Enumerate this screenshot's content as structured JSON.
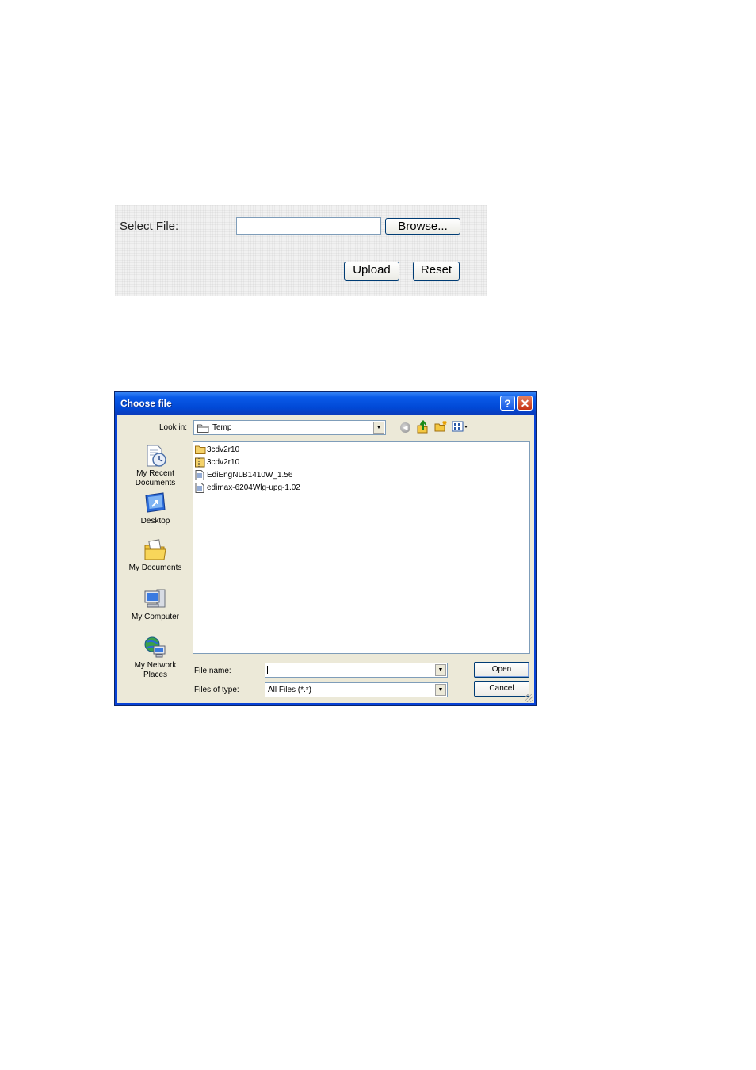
{
  "upload_form": {
    "select_file_label": "Select File:",
    "file_path_value": "",
    "browse_label": "Browse...",
    "upload_label": "Upload",
    "reset_label": "Reset"
  },
  "dialog": {
    "title": "Choose file",
    "help_glyph": "?",
    "close_glyph": "✕",
    "look_in_label": "Look in:",
    "look_in_value": "Temp",
    "toolbar_icons": [
      "back-icon",
      "up-one-level-icon",
      "new-folder-icon",
      "views-menu-icon"
    ],
    "places": [
      {
        "label": "My Recent Documents",
        "icon": "recent-documents-icon"
      },
      {
        "label": "Desktop",
        "icon": "desktop-icon"
      },
      {
        "label": "My Documents",
        "icon": "my-documents-icon"
      },
      {
        "label": "My Computer",
        "icon": "my-computer-icon"
      },
      {
        "label": "My Network Places",
        "icon": "network-places-icon"
      }
    ],
    "files": [
      {
        "name": "3cdv2r10",
        "icon": "folder-icon"
      },
      {
        "name": "3cdv2r10",
        "icon": "zip-folder-icon"
      },
      {
        "name": "EdiEngNLB1410W_1.56",
        "icon": "file-icon"
      },
      {
        "name": "edimax-6204Wlg-upg-1.02",
        "icon": "file-icon"
      }
    ],
    "file_name_label": "File name:",
    "file_name_value": "",
    "files_of_type_label": "Files of type:",
    "files_of_type_value": "All Files (*.*)",
    "open_label": "Open",
    "cancel_label": "Cancel"
  },
  "colors": {
    "title_bar": "#0a5ae8",
    "dialog_face": "#ece9d8",
    "close_button": "#c53213",
    "button_border": "#003c74"
  }
}
